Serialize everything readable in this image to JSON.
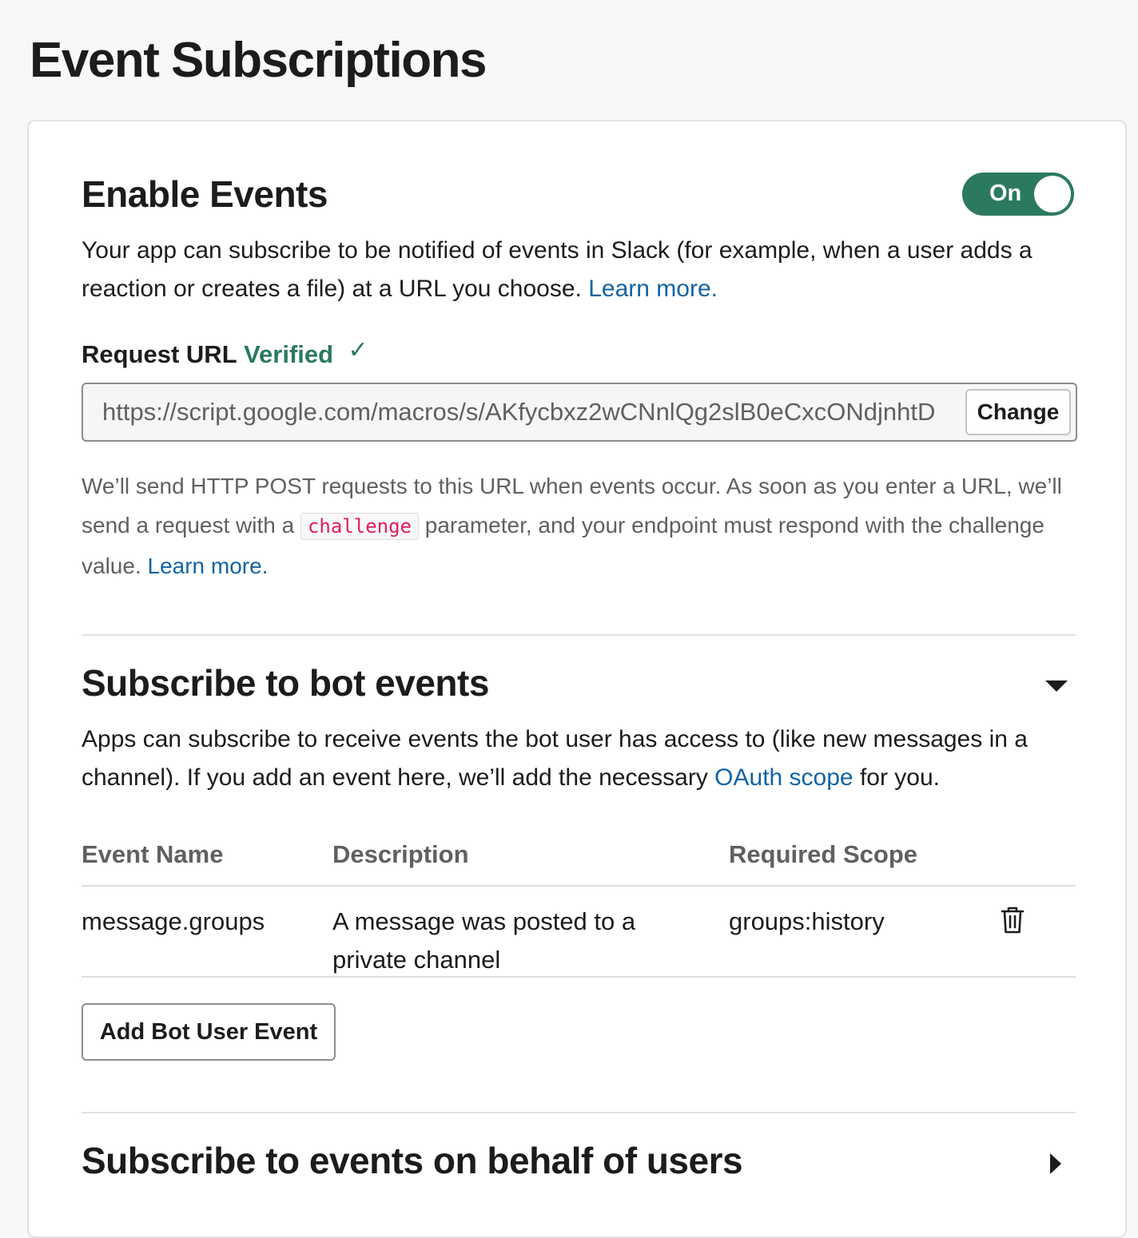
{
  "page": {
    "title": "Event Subscriptions"
  },
  "enable_events": {
    "title": "Enable Events",
    "toggle_label": "On",
    "description": "Your app can subscribe to be notified of events in Slack (for example, when a user adds a reaction or creates a file) at a URL you choose.",
    "learn_more": "Learn more."
  },
  "request_url": {
    "label": "Request URL",
    "status": "Verified",
    "check": "✓",
    "value": "https://script.google.com/macros/s/AKfycbxz2wCNnlQg2slB0eCxcONdjnhtD",
    "change_label": "Change",
    "help_part1": "We’ll send HTTP POST requests to this URL when events occur. As soon as you enter a URL, we’ll send a request with a",
    "help_code": "challenge",
    "help_part2": "parameter, and your endpoint must respond with the challenge value.",
    "help_link": "Learn more."
  },
  "bot_events": {
    "title": "Subscribe to bot events",
    "desc_part1": "Apps can subscribe to receive events the bot user has access to (like new messages in a channel). If you add an event here, we’ll add the necessary",
    "desc_link": "OAuth scope",
    "desc_part2": "for you.",
    "columns": {
      "event_name": "Event Name",
      "description": "Description",
      "scope": "Required Scope"
    },
    "rows": [
      {
        "event": "message.groups",
        "description": "A message was posted to a private channel",
        "scope": "groups:history"
      }
    ],
    "add_button": "Add Bot User Event",
    "icon": "chevron-down-icon"
  },
  "user_events": {
    "title": "Subscribe to events on behalf of users",
    "icon": "chevron-right-icon"
  },
  "colors": {
    "accent_green": "#2b7a5d",
    "link_blue": "#1264a3",
    "code_red": "#e01e5a"
  }
}
